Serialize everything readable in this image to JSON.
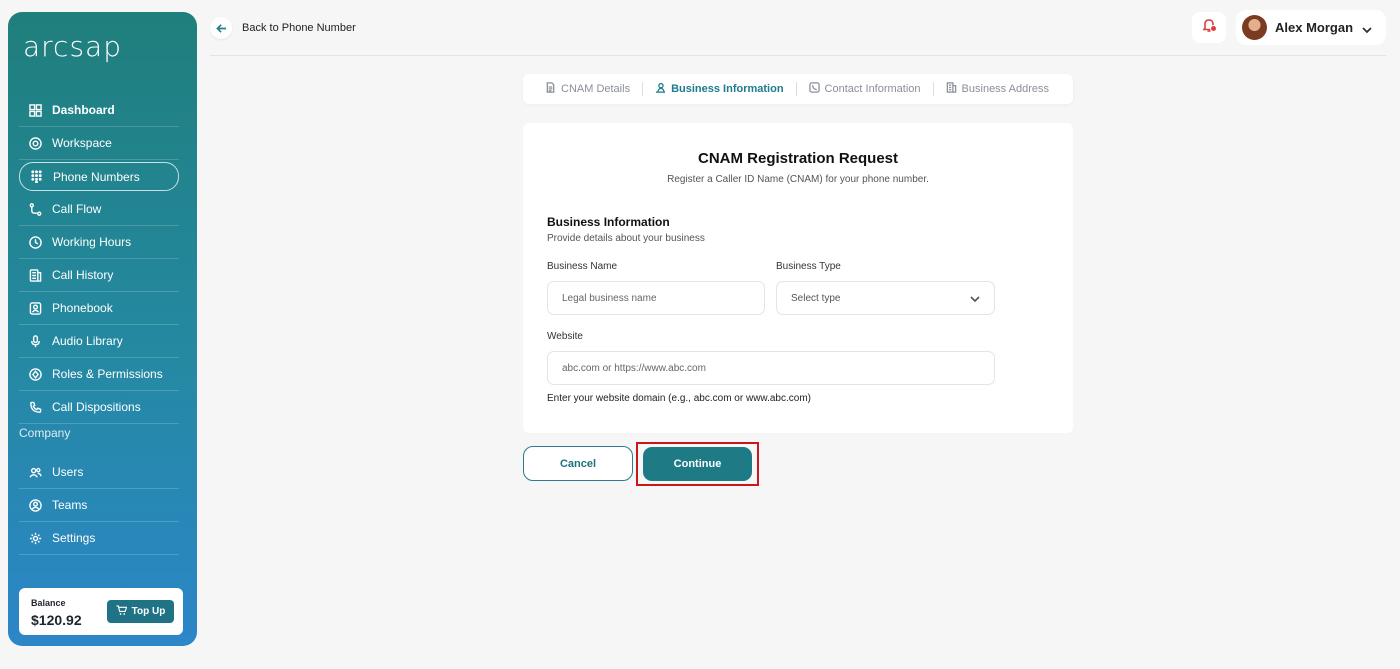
{
  "app": {
    "logo": "arcsap"
  },
  "sidebar": {
    "items": [
      {
        "label": "Dashboard",
        "icon": "grid-icon"
      },
      {
        "label": "Workspace",
        "icon": "lifebuoy-icon"
      },
      {
        "label": "Phone Numbers",
        "icon": "keypad-icon"
      },
      {
        "label": "Call Flow",
        "icon": "flow-icon"
      },
      {
        "label": "Working Hours",
        "icon": "clock-icon"
      },
      {
        "label": "Call History",
        "icon": "history-icon"
      },
      {
        "label": "Phonebook",
        "icon": "contact-book-icon"
      },
      {
        "label": "Audio Library",
        "icon": "microphone-icon"
      },
      {
        "label": "Roles & Permissions",
        "icon": "shield-icon"
      },
      {
        "label": "Call Dispositions",
        "icon": "phone-icon"
      }
    ],
    "section_label": "Company",
    "company_items": [
      {
        "label": "Users",
        "icon": "users-icon"
      },
      {
        "label": "Teams",
        "icon": "team-icon"
      },
      {
        "label": "Settings",
        "icon": "gear-icon"
      }
    ],
    "balance": {
      "label": "Balance",
      "value": "$120.92",
      "topup_label": "Top Up"
    }
  },
  "header": {
    "back_label": "Back to Phone Number",
    "user_name": "Alex Morgan"
  },
  "steps": [
    {
      "label": "CNAM Details",
      "active": false
    },
    {
      "label": "Business Information",
      "active": true
    },
    {
      "label": "Contact Information",
      "active": false
    },
    {
      "label": "Business Address",
      "active": false
    }
  ],
  "form": {
    "title": "CNAM Registration Request",
    "subtitle": "Register a Caller ID Name (CNAM) for your phone number.",
    "section_title": "Business Information",
    "section_subtitle": "Provide details about your business",
    "business_name_label": "Business Name",
    "business_name_placeholder": "Legal business name",
    "business_name_value": "",
    "business_type_label": "Business Type",
    "business_type_value": "Select type",
    "website_label": "Website",
    "website_placeholder": "abc.com or https://www.abc.com",
    "website_value": "",
    "website_hint": "Enter your website domain (e.g., abc.com or www.abc.com)"
  },
  "actions": {
    "cancel_label": "Cancel",
    "continue_label": "Continue"
  },
  "colors": {
    "accent": "#1e7a85",
    "highlight": "#c8161d"
  }
}
